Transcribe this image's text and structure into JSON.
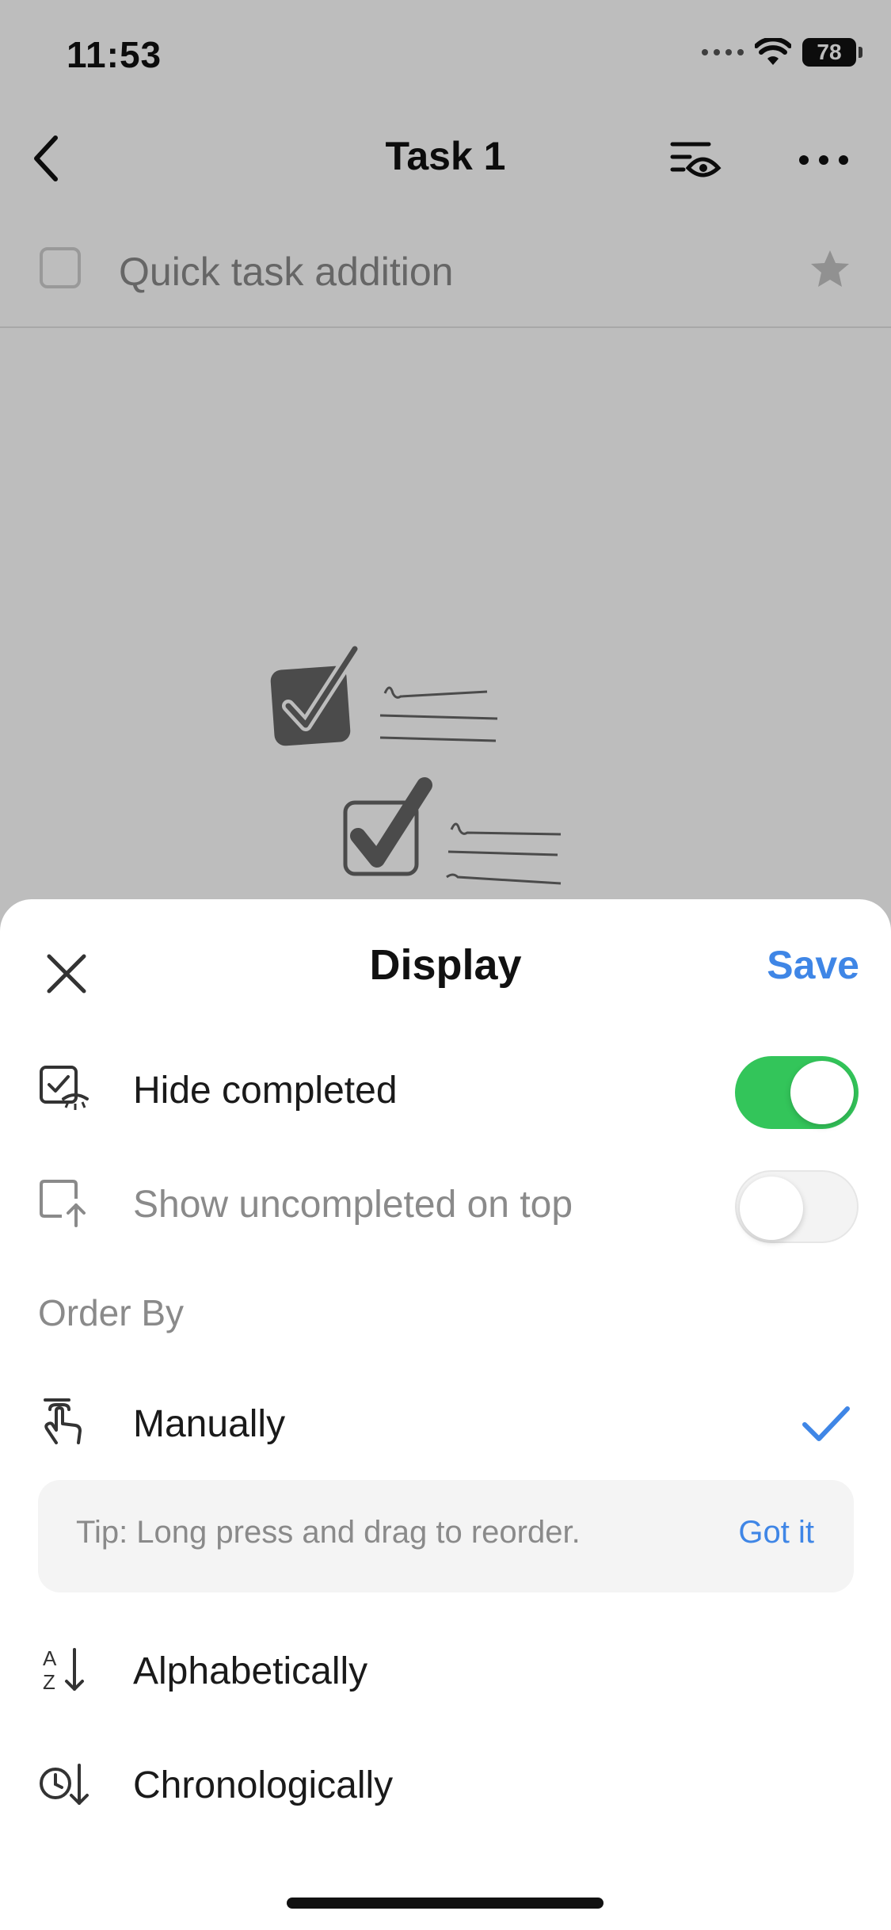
{
  "status_bar": {
    "time": "11:53",
    "battery": "78"
  },
  "nav": {
    "title": "Task 1"
  },
  "quick_add": {
    "placeholder": "Quick task addition"
  },
  "sheet": {
    "title": "Display",
    "save_label": "Save",
    "toggles": [
      {
        "label": "Hide completed",
        "on": true
      },
      {
        "label": "Show uncompleted on top",
        "on": false
      }
    ],
    "order_by_label": "Order By",
    "order_options": [
      {
        "label": "Manually",
        "selected": true
      },
      {
        "label": "Alphabetically",
        "selected": false
      },
      {
        "label": "Chronologically",
        "selected": false
      }
    ],
    "tip": {
      "text": "Tip: Long press and drag to reorder.",
      "action": "Got it"
    }
  },
  "colors": {
    "accent": "#3f86e6",
    "toggle_on": "#33c55a"
  }
}
